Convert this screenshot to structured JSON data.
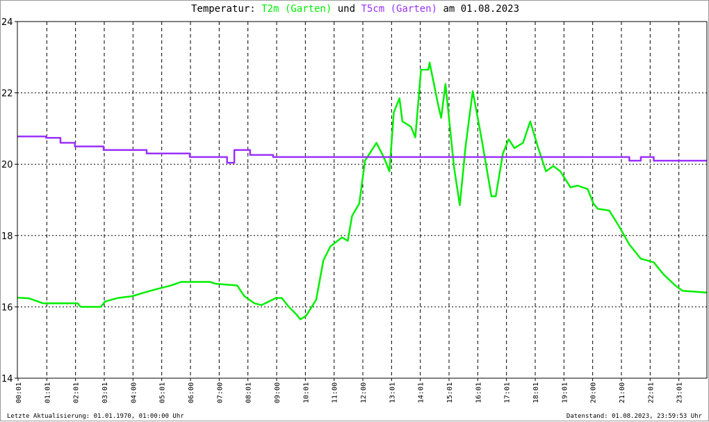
{
  "chart_data": {
    "type": "line",
    "title": {
      "prefix": "Temperatur: ",
      "series1": "T2m (Garten)",
      "middle": " und ",
      "series2": "T5cm (Garten)",
      "suffix": " am 01.08.2023"
    },
    "xlabel": "",
    "ylabel": "",
    "xlim": [
      0,
      24
    ],
    "ylim": [
      14,
      24
    ],
    "y_ticks": [
      14,
      16,
      18,
      20,
      22,
      24
    ],
    "x_ticks": [
      {
        "h": 0.0,
        "label": "00:01"
      },
      {
        "h": 1.0,
        "label": "01:01"
      },
      {
        "h": 2.0,
        "label": "02:01"
      },
      {
        "h": 3.0,
        "label": "03:01"
      },
      {
        "h": 4.0,
        "label": "04:00"
      },
      {
        "h": 5.0,
        "label": "05:01"
      },
      {
        "h": 6.0,
        "label": "06:00"
      },
      {
        "h": 7.0,
        "label": "07:00"
      },
      {
        "h": 8.0,
        "label": "08:01"
      },
      {
        "h": 9.0,
        "label": "09:00"
      },
      {
        "h": 10.0,
        "label": "10:01"
      },
      {
        "h": 11.0,
        "label": "11:00"
      },
      {
        "h": 12.0,
        "label": "12:00"
      },
      {
        "h": 13.0,
        "label": "13:01"
      },
      {
        "h": 14.0,
        "label": "14:01"
      },
      {
        "h": 15.0,
        "label": "15:01"
      },
      {
        "h": 16.0,
        "label": "16:01"
      },
      {
        "h": 17.0,
        "label": "17:01"
      },
      {
        "h": 18.0,
        "label": "18:01"
      },
      {
        "h": 19.0,
        "label": "19:01"
      },
      {
        "h": 20.0,
        "label": "20:00"
      },
      {
        "h": 21.0,
        "label": "21:00"
      },
      {
        "h": 22.0,
        "label": "22:01"
      },
      {
        "h": 23.0,
        "label": "23:01"
      }
    ],
    "grid": true,
    "series": [
      {
        "name": "T2m (Garten)",
        "color": "#00ee00",
        "points": [
          [
            0,
            16.26
          ],
          [
            0.4,
            16.24
          ],
          [
            0.9,
            16.1
          ],
          [
            2.1,
            16.1
          ],
          [
            2.2,
            16.0
          ],
          [
            2.9,
            16.0
          ],
          [
            3.05,
            16.15
          ],
          [
            3.5,
            16.25
          ],
          [
            4.0,
            16.3
          ],
          [
            4.4,
            16.4
          ],
          [
            4.85,
            16.5
          ],
          [
            5.35,
            16.6
          ],
          [
            5.7,
            16.7
          ],
          [
            6.7,
            16.7
          ],
          [
            6.9,
            16.65
          ],
          [
            7.65,
            16.6
          ],
          [
            7.9,
            16.3
          ],
          [
            8.25,
            16.1
          ],
          [
            8.5,
            16.05
          ],
          [
            8.75,
            16.15
          ],
          [
            9.0,
            16.25
          ],
          [
            9.2,
            16.25
          ],
          [
            9.45,
            16.0
          ],
          [
            9.7,
            15.8
          ],
          [
            9.85,
            15.65
          ],
          [
            10.05,
            15.75
          ],
          [
            10.4,
            16.2
          ],
          [
            10.65,
            17.3
          ],
          [
            10.9,
            17.7
          ],
          [
            11.3,
            17.95
          ],
          [
            11.5,
            17.85
          ],
          [
            11.65,
            18.55
          ],
          [
            11.9,
            18.9
          ],
          [
            12.1,
            20.1
          ],
          [
            12.5,
            20.6
          ],
          [
            12.75,
            20.2
          ],
          [
            12.95,
            19.8
          ],
          [
            13.1,
            21.45
          ],
          [
            13.3,
            21.85
          ],
          [
            13.4,
            21.2
          ],
          [
            13.7,
            21.05
          ],
          [
            13.85,
            20.75
          ],
          [
            14.05,
            22.65
          ],
          [
            14.3,
            22.65
          ],
          [
            14.35,
            22.85
          ],
          [
            14.65,
            21.65
          ],
          [
            14.75,
            21.3
          ],
          [
            14.9,
            22.25
          ],
          [
            15.2,
            19.9
          ],
          [
            15.4,
            18.85
          ],
          [
            15.6,
            20.5
          ],
          [
            15.85,
            22.05
          ],
          [
            16.15,
            20.75
          ],
          [
            16.5,
            19.1
          ],
          [
            16.65,
            19.1
          ],
          [
            16.9,
            20.3
          ],
          [
            17.1,
            20.7
          ],
          [
            17.3,
            20.45
          ],
          [
            17.6,
            20.6
          ],
          [
            17.85,
            21.2
          ],
          [
            18.15,
            20.4
          ],
          [
            18.4,
            19.8
          ],
          [
            18.65,
            19.95
          ],
          [
            18.9,
            19.8
          ],
          [
            19.25,
            19.35
          ],
          [
            19.5,
            19.4
          ],
          [
            19.85,
            19.3
          ],
          [
            20.05,
            18.9
          ],
          [
            20.2,
            18.75
          ],
          [
            20.6,
            18.7
          ],
          [
            20.95,
            18.25
          ],
          [
            21.3,
            17.75
          ],
          [
            21.7,
            17.35
          ],
          [
            22.15,
            17.25
          ],
          [
            22.5,
            16.9
          ],
          [
            22.9,
            16.6
          ],
          [
            23.15,
            16.45
          ],
          [
            24,
            16.4
          ]
        ]
      },
      {
        "name": "T5cm (Garten)",
        "color": "#9b30ff",
        "points": [
          [
            0,
            20.78
          ],
          [
            1.0,
            20.78
          ],
          [
            1.0,
            20.74
          ],
          [
            1.5,
            20.74
          ],
          [
            1.5,
            20.6
          ],
          [
            2.0,
            20.6
          ],
          [
            2.0,
            20.5
          ],
          [
            3.0,
            20.5
          ],
          [
            3.0,
            20.4
          ],
          [
            4.5,
            20.4
          ],
          [
            4.5,
            20.3
          ],
          [
            6.0,
            20.3
          ],
          [
            6.0,
            20.2
          ],
          [
            7.3,
            20.2
          ],
          [
            7.3,
            20.04
          ],
          [
            7.55,
            20.04
          ],
          [
            7.55,
            20.4
          ],
          [
            8.1,
            20.4
          ],
          [
            8.1,
            20.26
          ],
          [
            8.9,
            20.26
          ],
          [
            8.9,
            20.2
          ],
          [
            21.3,
            20.2
          ],
          [
            21.3,
            20.1
          ],
          [
            21.7,
            20.1
          ],
          [
            21.7,
            20.2
          ],
          [
            22.15,
            20.2
          ],
          [
            22.15,
            20.1
          ],
          [
            24,
            20.1
          ]
        ]
      }
    ]
  },
  "footer": {
    "left": "Letzte Aktualisierung: 01.01.1970, 01:00:00 Uhr",
    "right": "Datenstand: 01.08.2023, 23:59:53 Uhr"
  }
}
